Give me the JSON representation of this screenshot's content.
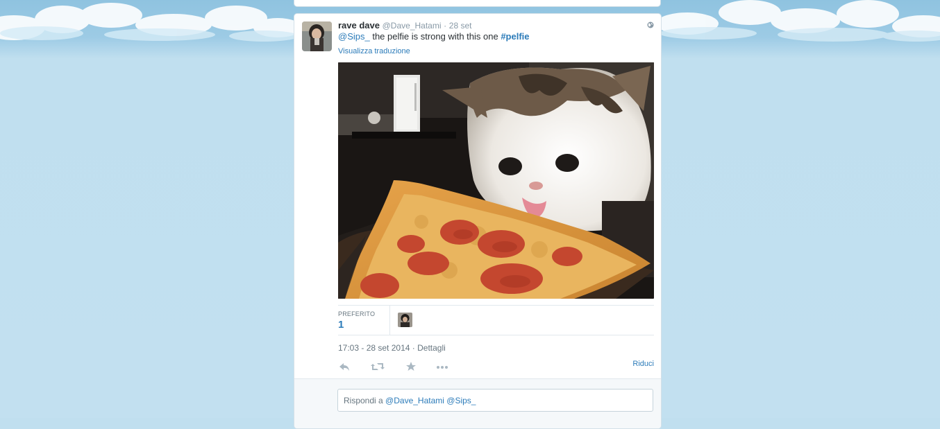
{
  "tweet": {
    "author_name": "rave dave",
    "author_handle": "@Dave_Hatami",
    "separator": "·",
    "date": "28 set",
    "text_mention": "@Sips_",
    "text_body": " the pelfie is strong with this one ",
    "text_hashtag": "#pelfie",
    "translate_link": "Visualizza traduzione"
  },
  "stats": {
    "favorites_label": "PREFERITO",
    "favorites_count": "1"
  },
  "meta": {
    "timestamp": "17:03 - 28 set 2014",
    "separator": "·",
    "details_link": "Dettagli"
  },
  "actions": {
    "reply_icon": "reply-icon",
    "retweet_icon": "retweet-icon",
    "favorite_icon": "star-icon",
    "more_icon": "more-icon",
    "collapse_label": "Riduci"
  },
  "reply": {
    "prefix": "Rispondi a ",
    "mention1": "@Dave_Hatami",
    "mention2": "@Sips_"
  },
  "colors": {
    "link": "#2b7bb9",
    "background": "#c0dfef",
    "icon_gray": "#aab8c2"
  }
}
